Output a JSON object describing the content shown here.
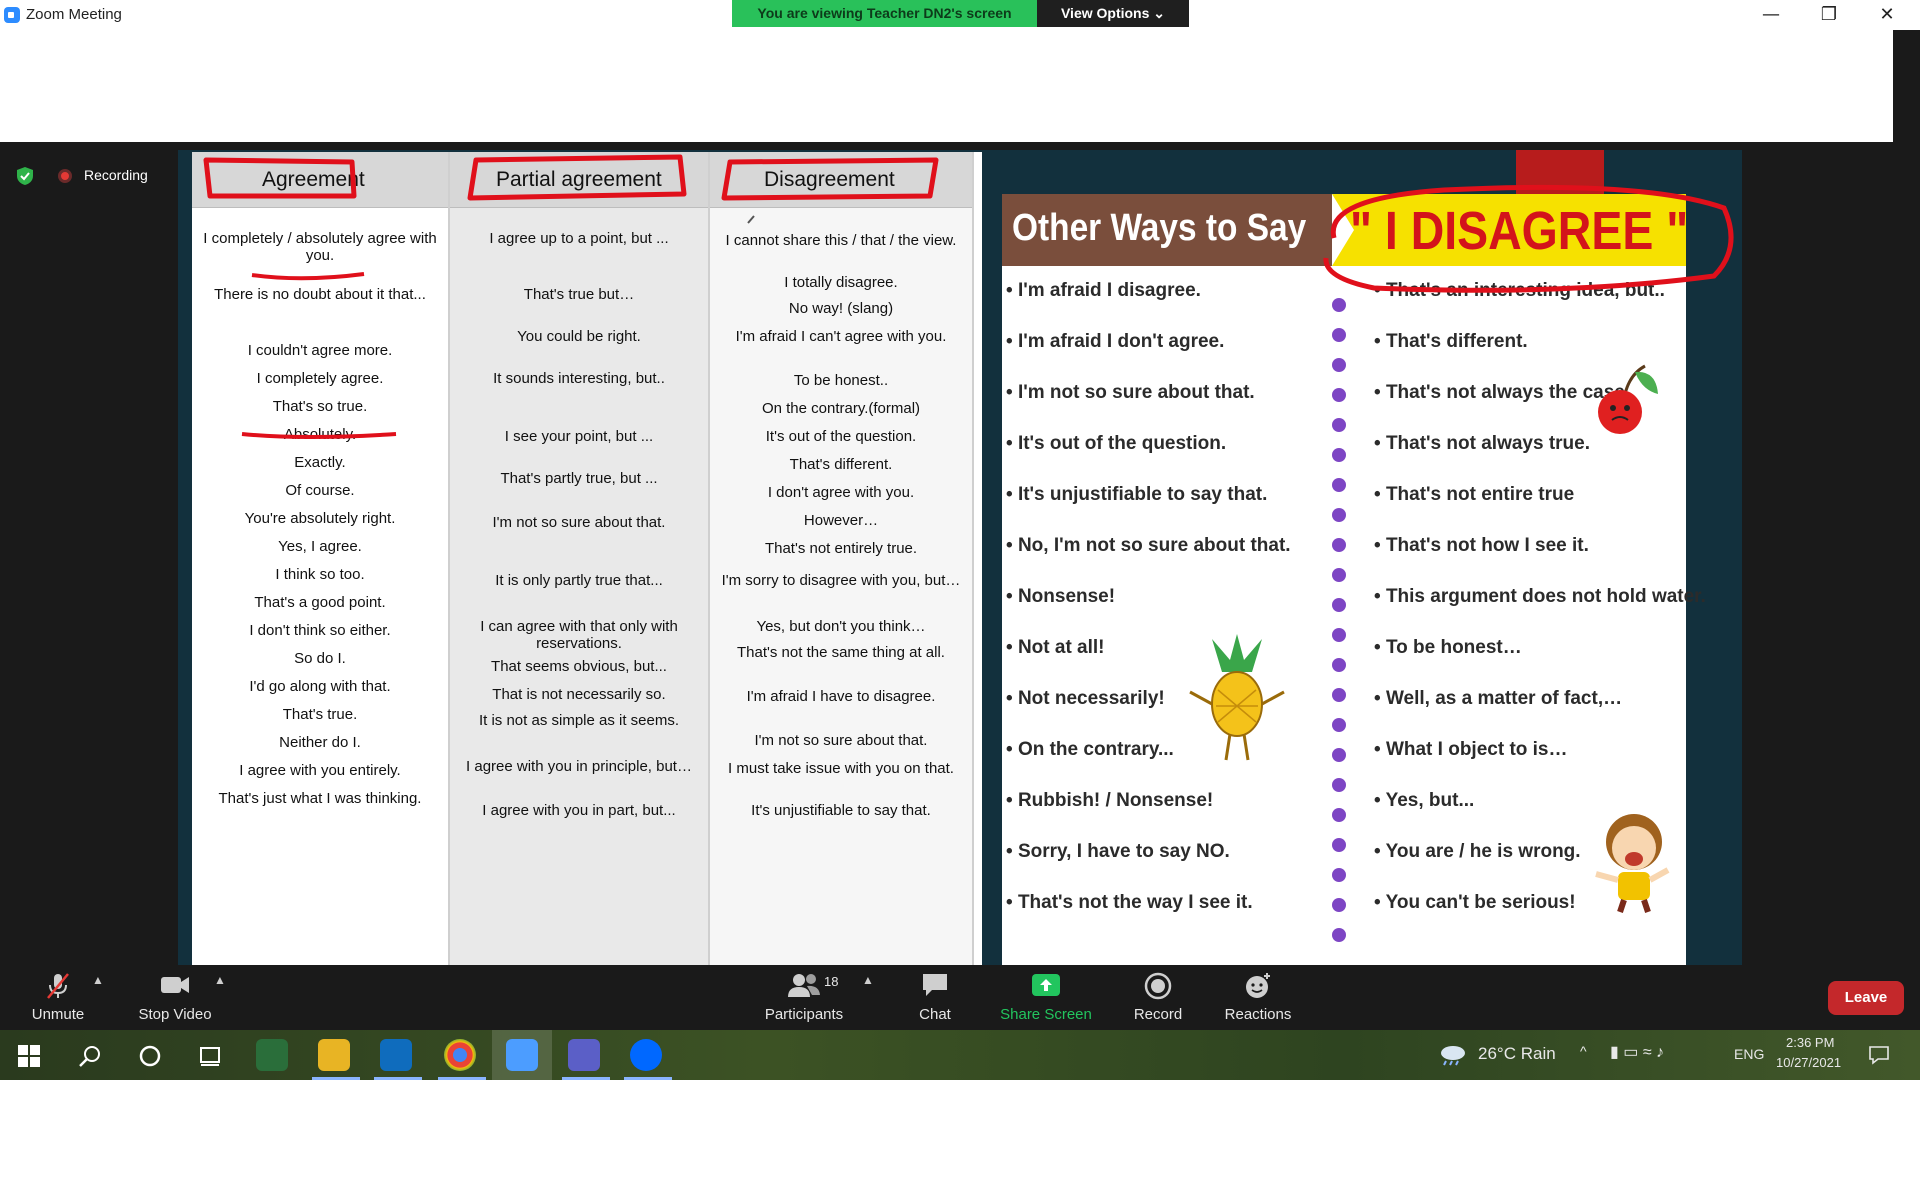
{
  "window": {
    "title": "Zoom Meeting"
  },
  "banner": {
    "viewing": "You are viewing Teacher DN2's screen",
    "view_options": "View Options ⌄"
  },
  "status": {
    "recording": "Recording"
  },
  "table": {
    "headers": [
      "Agreement",
      "Partial agreement",
      "Disagreement"
    ],
    "agreement": [
      "I completely / absolutely agree with you.",
      "There is no doubt about it that...",
      "I couldn't agree more.",
      "I completely agree.",
      "That's so true.",
      "Absolutely.",
      "Exactly.",
      "Of course.",
      "You're absolutely right.",
      "Yes, I agree.",
      "I think so too.",
      "That's a good point.",
      "I don't think so either.",
      "So do I.",
      "I'd go along with that.",
      "That's true.",
      "Neither do I.",
      "I agree with you entirely.",
      "That's just what I was thinking."
    ],
    "partial": [
      "I agree up to a point, but ...",
      "That's true but…",
      "You could be right.",
      "It sounds interesting, but..",
      "I see your point, but ...",
      "That's partly true, but ...",
      "I'm not so sure about that.",
      "It is only partly true that...",
      "I can agree with that only with reservations.",
      "That seems obvious, but...",
      "That is not necessarily so.",
      "It is not as simple as it seems.",
      "I agree with you in principle, but…",
      "I agree with you in part, but..."
    ],
    "disagreement": [
      "I cannot share this / that / the view.",
      "I totally disagree.",
      "No way! (slang)",
      "I'm afraid I can't agree with you.",
      "To be honest..",
      "On the contrary.(formal)",
      "It's out of the question.",
      "That's different.",
      "I don't agree with you.",
      "However…",
      "That's not entirely true.",
      "I'm sorry to disagree with you, but…",
      "Yes, but don't you think…",
      "That's not the same thing at all.",
      "I'm afraid I have to disagree.",
      "I'm not so sure about that.",
      "I must take issue with you on that.",
      "It's unjustifiable to say that."
    ]
  },
  "infographic": {
    "heading_left": "Other Ways to Say",
    "heading_right": "\" I DISAGREE \"",
    "left": [
      "I'm afraid I disagree.",
      "I'm afraid I don't agree.",
      "I'm not so sure about that.",
      "It's out of the question.",
      "It's unjustifiable to say that.",
      "No, I'm not so sure about that.",
      "Nonsense!",
      "Not at all!",
      "Not necessarily!",
      "On the contrary...",
      "Rubbish! / Nonsense!",
      "Sorry, I have to say NO.",
      "That's not the way I see it."
    ],
    "right": [
      "That's an interesting idea, but..",
      "That's different.",
      "That's not always the case.",
      "That's not always true.",
      "That's not entire true",
      "That's not how I see it.",
      "This argument does not hold water.",
      "To be honest…",
      "Well, as a matter of fact,…",
      "What I object to is…",
      "Yes, but...",
      "You are / he is wrong.",
      "You can't be serious!"
    ]
  },
  "toolbar": {
    "unmute": "Unmute",
    "stop_video": "Stop Video",
    "participants": "Participants",
    "participants_count": "18",
    "chat": "Chat",
    "share_screen": "Share Screen",
    "record": "Record",
    "reactions": "Reactions",
    "leave": "Leave"
  },
  "taskbar": {
    "weather": "26°C  Rain",
    "lang": "ENG",
    "time": "2:36 PM",
    "date": "10/27/2021"
  },
  "colors": {
    "accent_green": "#29c15a",
    "leave_red": "#c4282b",
    "highlight_red": "#e0101b",
    "brand_brown": "#7a4e3c",
    "brand_yellow": "#f6e100",
    "dot_purple": "#7d45c4"
  }
}
